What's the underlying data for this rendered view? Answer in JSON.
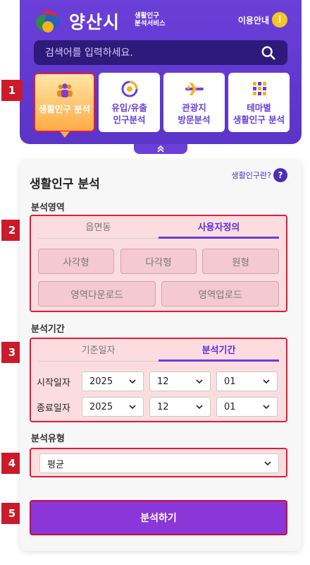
{
  "header": {
    "city_name": "양산시",
    "sub_title_line1": "생활인구",
    "sub_title_line2": "분석서비스",
    "guide_label": "이용안내",
    "guide_icon": "i",
    "search_placeholder": "검색어를 입력하세요.",
    "cards": [
      {
        "label": "생활인구 분석",
        "icon": "people-icon",
        "active": true
      },
      {
        "label": "유입/유출\n인구분석",
        "icon": "flow-icon",
        "active": false
      },
      {
        "label": "관광지\n방문분석",
        "icon": "airplane-icon",
        "active": false
      },
      {
        "label": "테마별\n생활인구 분석",
        "icon": "grid-icon",
        "active": false
      }
    ]
  },
  "markers": [
    "1",
    "2",
    "3",
    "4",
    "5"
  ],
  "panel": {
    "title": "생활인구 분석",
    "help_label": "생활인구란?",
    "help_icon": "?",
    "area": {
      "label": "분석영역",
      "tabs": [
        "읍면동",
        "사용자정의"
      ],
      "active_tab": 1,
      "shapes": [
        "사각형",
        "다각형",
        "원형"
      ],
      "actions": [
        "영역다운로드",
        "영역업로드"
      ]
    },
    "period": {
      "label": "분석기간",
      "tabs": [
        "기준일자",
        "분석기간"
      ],
      "active_tab": 1,
      "start_label": "시작일자",
      "end_label": "종료일자",
      "start": {
        "year": "2025",
        "month": "12",
        "day": "01"
      },
      "end": {
        "year": "2025",
        "month": "12",
        "day": "01"
      }
    },
    "type": {
      "label": "분석유형",
      "selected": "평균"
    },
    "run_label": "분석하기"
  },
  "colors": {
    "header_purple": "#6a3fd8",
    "marker_red": "#cc1a2a",
    "highlight_border": "#e41b3a",
    "run_button": "#8a36d8"
  }
}
